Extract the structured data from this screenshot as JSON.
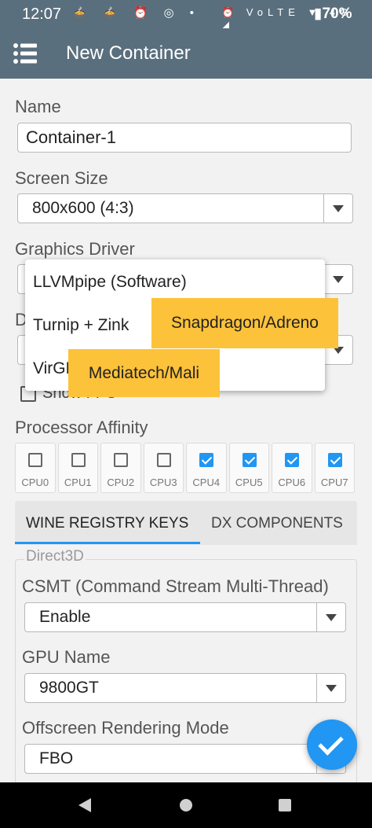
{
  "status_bar": {
    "time": "12:07",
    "left_icons": "🍲 🍲 ⏰ ◎ •",
    "right_icons": "⏰ VoLTE ▼ 4G ◢",
    "battery": "▮70%"
  },
  "app_bar": {
    "title": "New Container",
    "menu_icon": "menu-list-icon"
  },
  "form": {
    "name_label": "Name",
    "name_value": "Container-1",
    "screen_size_label": "Screen Size",
    "screen_size_value": "800x600 (4:3)",
    "graphics_driver_label": "Graphics Driver",
    "dxwrapper_label_partial": "D",
    "show_fps_label": "Show FPS",
    "processor_affinity_label": "Processor Affinity",
    "cpus": [
      {
        "label": "CPU0",
        "checked": false
      },
      {
        "label": "CPU1",
        "checked": false
      },
      {
        "label": "CPU2",
        "checked": false
      },
      {
        "label": "CPU3",
        "checked": false
      },
      {
        "label": "CPU4",
        "checked": true
      },
      {
        "label": "CPU5",
        "checked": true
      },
      {
        "label": "CPU6",
        "checked": true
      },
      {
        "label": "CPU7",
        "checked": true
      }
    ]
  },
  "tabs": {
    "active": "WINE REGISTRY KEYS",
    "inactive": "DX COMPONENTS"
  },
  "direct3d": {
    "group_title": "Direct3D",
    "csmt_label": "CSMT (Command Stream Multi-Thread)",
    "csmt_value": "Enable",
    "gpu_name_label": "GPU Name",
    "gpu_name_value": "9800GT",
    "offscreen_label": "Offscreen Rendering Mode",
    "offscreen_value": "FBO"
  },
  "dropdown": {
    "items": [
      "LLVMpipe (Software)",
      "Turnip + Zink",
      "VirGL"
    ],
    "tags": [
      "Snapdragon/Adreno",
      "Mediatech/Mali"
    ]
  },
  "colors": {
    "accent": "#2196f3",
    "app_bar": "#5a6f7d",
    "tag": "#fcc23a"
  }
}
